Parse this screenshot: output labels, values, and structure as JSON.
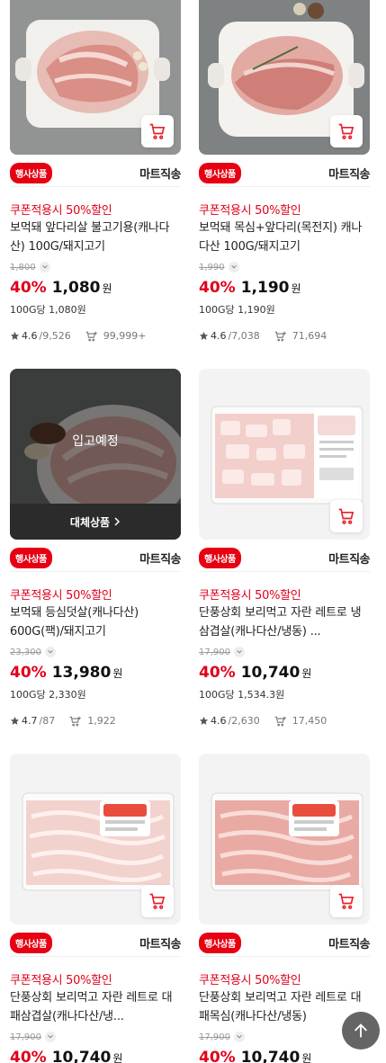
{
  "products": [
    {
      "event_badge": "행사상품",
      "delivery": "마트직송",
      "coupon": "쿠폰적용시 50%할인",
      "name": "보먹돼 앞다리살 불고기용(캐나다산) 100G/돼지고기",
      "original_price": "1,800",
      "discount": "40%",
      "price": "1,080",
      "currency": "원",
      "unit_price": "100G당 1,080원",
      "rating": "4.6",
      "reviews": "/9,526",
      "cart_count": "99,999+",
      "status": ""
    },
    {
      "event_badge": "행사상품",
      "delivery": "마트직송",
      "coupon": "쿠폰적용시 50%할인",
      "name": "보먹돼 목심+앞다리(목전지) 캐나다산 100G/돼지고기",
      "original_price": "1,990",
      "discount": "40%",
      "price": "1,190",
      "currency": "원",
      "unit_price": "100G당 1,190원",
      "rating": "4.6",
      "reviews": "/7,038",
      "cart_count": "71,694",
      "status": ""
    },
    {
      "event_badge": "행사상품",
      "delivery": "마트직송",
      "coupon": "쿠폰적용시 50%할인",
      "name": "보먹돼 등심덧살(캐나다산) 600G(팩)/돼지고기",
      "original_price": "23,300",
      "discount": "40%",
      "price": "13,980",
      "currency": "원",
      "unit_price": "100G당 2,330원",
      "rating": "4.7",
      "reviews": "/87",
      "cart_count": "1,922",
      "status": "입고예정",
      "substitute_label": "대체상품"
    },
    {
      "event_badge": "행사상품",
      "delivery": "마트직송",
      "coupon": "쿠폰적용시 50%할인",
      "name": "단풍상회 보리먹고 자란 레트로 냉삼겹살(캐나다산/냉동) ...",
      "original_price": "17,900",
      "discount": "40%",
      "price": "10,740",
      "currency": "원",
      "unit_price": "100G당 1,534.3원",
      "rating": "4.6",
      "reviews": "/2,630",
      "cart_count": "17,450",
      "status": ""
    },
    {
      "event_badge": "행사상품",
      "delivery": "마트직송",
      "coupon": "쿠폰적용시 50%할인",
      "name": "단풍상회 보리먹고 자란 레트로 대패삼겹살(캐나다산/냉...",
      "original_price": "17,900",
      "discount": "40%",
      "price": "10,740",
      "currency": "원",
      "unit_price": "",
      "rating": "",
      "reviews": "",
      "cart_count": "",
      "status": ""
    },
    {
      "event_badge": "행사상품",
      "delivery": "마트직송",
      "coupon": "쿠폰적용시 50%할인",
      "name": "단풍상회 보리먹고 자란 레트로 대패목심(캐나다산/냉동)",
      "original_price": "17,900",
      "discount": "40%",
      "price": "10,740",
      "currency": "원",
      "unit_price": "",
      "rating": "",
      "reviews": "",
      "cart_count": "",
      "status": ""
    }
  ],
  "icons": {
    "cart": "shopping-cart-icon",
    "star": "star-icon",
    "cart_count": "cart-plus-icon",
    "scroll_top": "arrow-up-icon"
  },
  "colors": {
    "accent_red": "#e0001a",
    "badge_red": "#e60012",
    "cart_icon_red": "#e8212e"
  }
}
